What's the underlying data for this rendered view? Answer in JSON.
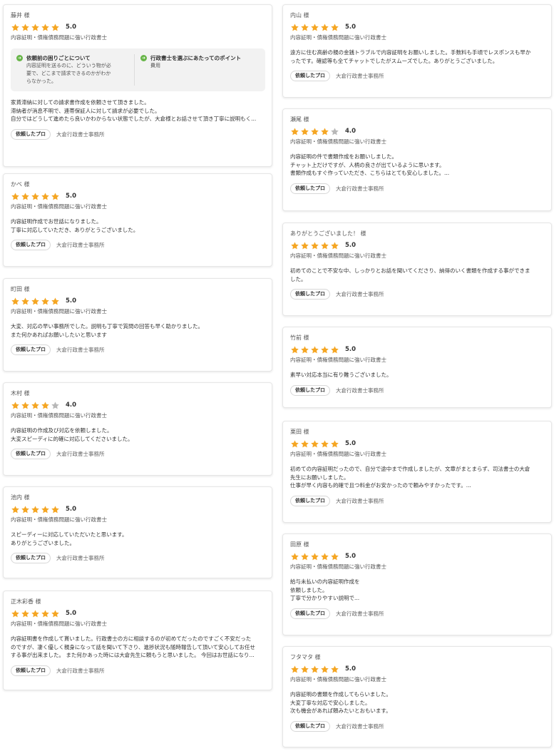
{
  "colors": {
    "star_on": "#f5a623",
    "star_off": "#b8b8b8",
    "qa_icon": "#67b548"
  },
  "icons": {
    "star": "star-icon",
    "qa": "arrow-right-circle-icon"
  },
  "tag_label": "依頼したプロ",
  "office_name": "大倉行政書士事務所",
  "left_reviews": [
    {
      "name": "藤井 様",
      "stars": 5,
      "score": "5.0",
      "category": "内容証明・債権債務問題に強い行政書士",
      "qa": [
        {
          "title": "依頼前の困りごとについて",
          "text": "内容証明を送るのに、どういう物が必\n要で、どこまで請求できるのかがわか\nらなかった。"
        },
        {
          "title": "行政書士を選ぶにあたってのポイント",
          "text": "費用"
        }
      ],
      "body": "家賃滞納に対しての請求書作成を依頼させて頂きました。\n滞納者が消息不明で、連帯保証人に対して請求が必要でした。\n自分ではどうして進めたら良いかわからない状態でしたが、大倉様とお話させて頂き丁寧に説明もく..."
    },
    {
      "name": "かべ 様",
      "stars": 5,
      "score": "5.0",
      "category": "内容証明・債権債務問題に強い行政書士",
      "body": "内容証明作成でお世話になりました。\n丁寧に対応していただき、ありがとうございました。"
    },
    {
      "name": "町田 様",
      "stars": 5,
      "score": "5.0",
      "category": "内容証明・債権債務問題に強い行政書士",
      "body": "大変、対応の早い事務所でした。説明も丁寧で質問の回答も早く助かりました。\nまた何かあればお願いしたいと思います"
    },
    {
      "name": "木村 様",
      "stars": 4,
      "score": "4.0",
      "category": "内容証明・債権債務問題に強い行政書士",
      "body": "内容証明の作成及び対応を依頼しました。\n大変スピーディに的確に対応してくださいました。"
    },
    {
      "name": "池内 様",
      "stars": 5,
      "score": "5.0",
      "category": "内容証明・債権債務問題に強い行政書士",
      "body": "スピーディーに対応していただいたと思います。\nありがとうございました。"
    },
    {
      "name": "正木彩香 様",
      "stars": 5,
      "score": "5.0",
      "category": "内容証明・債権債務問題に強い行政書士",
      "body": "内容証明書を作成して貰いました。行政書士の方に相談するのが初めてだったのですごく不安だった\nのですが、凄く優しく親身になって話を聞いて下さり、進捗状況も随時報告して頂いて安心してお任せ\nする事が出来ました。 また何かあった時には大倉先生に頼もうと思いました。 今回はお世話になり..."
    }
  ],
  "right_reviews": [
    {
      "name": "内山 様",
      "stars": 5,
      "score": "5.0",
      "category": "内容証明・債権債務問題に強い行政書士",
      "body": "遠方に住む高齢の親の金銭トラブルで内容証明をお願いしました。手数料も手頃でレスポンスも早か\nったです。確認等も全てチャットでしたがスムーズでした。ありがとうございました。"
    },
    {
      "name": "瀬尾 様",
      "stars": 4,
      "score": "4.0",
      "category": "内容証明・債権債務問題に強い行政書士",
      "body": "内容証明の件で書類作成をお願いしました。\nチャット上だけですが、人柄の良さが出ているように思います。\n書類作成もすぐ作っていただき、こちらはとても安心しました。..."
    },
    {
      "name": "ありがとうございました！ 様",
      "stars": 5,
      "score": "5.0",
      "category": "内容証明・債権債務問題に強い行政書士",
      "body": "初めてのことで不安な中、しっかりとお話を聞いてくださり、納得のいく書類を作成する事ができま\nした。"
    },
    {
      "name": "竹前 様",
      "stars": 5,
      "score": "5.0",
      "category": "内容証明・債権債務問題に強い行政書士",
      "body": "素早い対応本当に有り難うございました。"
    },
    {
      "name": "栗田 様",
      "stars": 5,
      "score": "5.0",
      "category": "内容証明・債権債務問題に強い行政書士",
      "body": "初めての内容証明だったので、自分で途中まで作成しましたが、文章がまとまらず、司法書士の大倉\n先生にお願いしました。\n仕事が早く内容も的確で且つ料金がお安かったので頼みやすかったです。..."
    },
    {
      "name": "田原 様",
      "stars": 5,
      "score": "5.0",
      "category": "内容証明・債権債務問題に強い行政書士",
      "body": "給与未払いの内容証明作成を\n依頼しました。\n丁寧で分かりやすい説明で..."
    },
    {
      "name": "フタマタ 様",
      "stars": 5,
      "score": "5.0",
      "category": "内容証明・債権債務問題に強い行政書士",
      "body": "内容証明の書類を作成してもらいました。\n大変丁寧な対応で安心しました。\n次も機会があれば頼みたいとおもいます。"
    }
  ]
}
